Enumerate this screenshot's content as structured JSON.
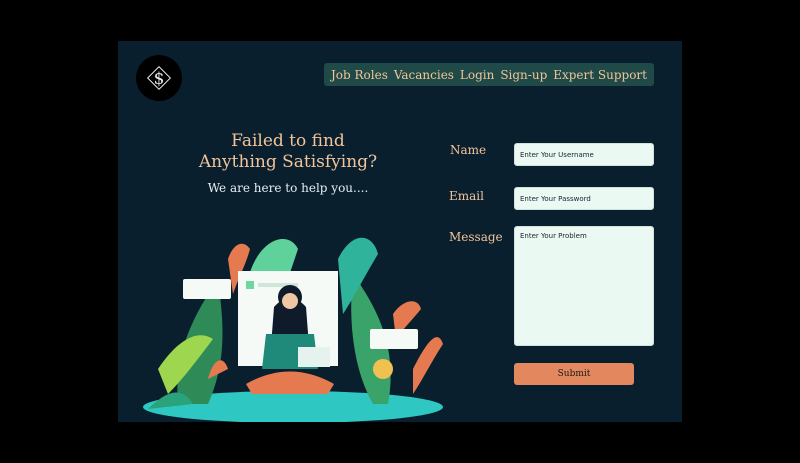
{
  "logo": {
    "glyph": "$",
    "icon": "dollar-logo-icon"
  },
  "nav": {
    "items": [
      "Job Roles",
      "Vacancies",
      "Login",
      "Sign-up",
      "Expert Support"
    ]
  },
  "hero": {
    "title_line1": "Failed to find",
    "title_line2": "Anything Satisfying?",
    "subtitle": "We are here to help you...."
  },
  "form": {
    "name_label": "Name",
    "name_placeholder": "Enter Your Username",
    "email_label": "Email",
    "email_placeholder": "Enter Your Password",
    "message_label": "Message",
    "message_placeholder": "Enter Your Problem",
    "submit_label": "Submit"
  },
  "colors": {
    "background": "#0a1f2e",
    "nav_bar": "#1f4a48",
    "accent_text": "#f2c49a",
    "input_bg": "#eafaf2",
    "submit_bg": "#e3875f"
  }
}
